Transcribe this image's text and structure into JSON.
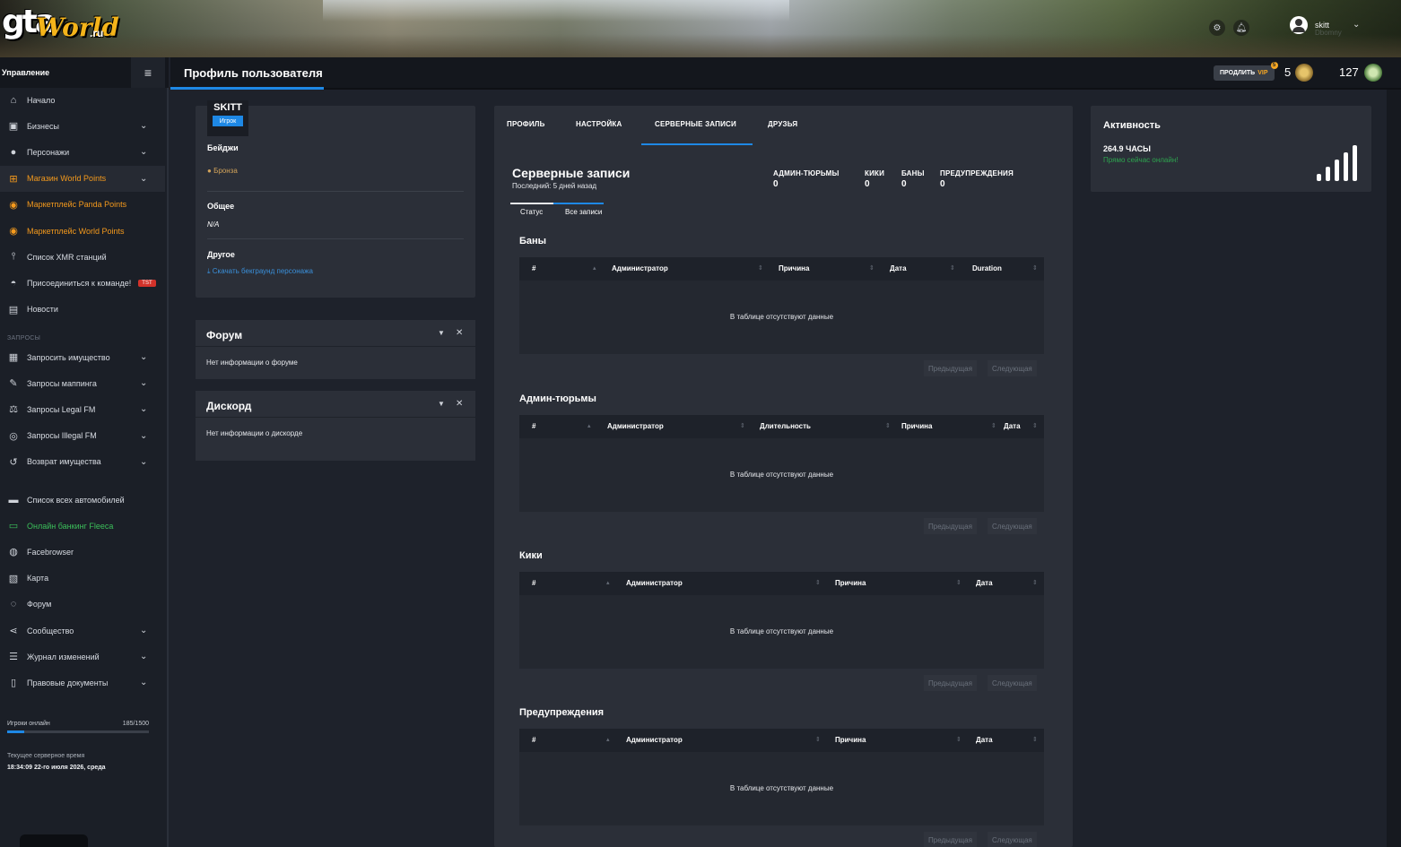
{
  "brand": {
    "logo_gta": "gta",
    "logo_world": "World",
    "logo_ru": ".ru",
    "accent": "#1e88e5",
    "orange": "#f59a1c",
    "green": "#3bbf5a"
  },
  "topbar": {
    "user_name": "skitt",
    "user_sub": "Dbomny"
  },
  "sidebar": {
    "title": "Управление",
    "items_main": [
      {
        "label": "Начало",
        "icon": "home-icon",
        "chevron": false,
        "style": ""
      },
      {
        "label": "Бизнесы",
        "icon": "briefcase-icon",
        "chevron": true,
        "style": ""
      },
      {
        "label": "Персонажи",
        "icon": "user-icon",
        "chevron": true,
        "style": ""
      },
      {
        "label": "Магазин World Points",
        "icon": "cart-icon",
        "chevron": true,
        "style": "orange"
      },
      {
        "label": "Маркетплейс Panda Points",
        "icon": "coins-icon",
        "chevron": false,
        "style": "orange"
      },
      {
        "label": "Маркетплейс World Points",
        "icon": "coins-icon",
        "chevron": false,
        "style": "orange"
      },
      {
        "label": "Список XMR станций",
        "icon": "antenna-icon",
        "chevron": false,
        "style": ""
      },
      {
        "label": "Присоединиться к команде!",
        "icon": "user-tie-icon",
        "chevron": false,
        "style": ""
      },
      {
        "label": "Новости",
        "icon": "newspaper-icon",
        "chevron": false,
        "style": ""
      }
    ],
    "tst_badge": "TST",
    "section_requests": "ЗАПРОСЫ",
    "items_requests": [
      {
        "label": "Запросить имущество",
        "icon": "building-icon",
        "chevron": true,
        "style": ""
      },
      {
        "label": "Запросы маппинга",
        "icon": "brush-icon",
        "chevron": true,
        "style": ""
      },
      {
        "label": "Запросы Legal FM",
        "icon": "scale-icon",
        "chevron": true,
        "style": ""
      },
      {
        "label": "Запросы Illegal FM",
        "icon": "mask-icon",
        "chevron": true,
        "style": ""
      },
      {
        "label": "Возврат имущества",
        "icon": "undo-icon",
        "chevron": true,
        "style": ""
      }
    ],
    "items_other": [
      {
        "label": "Список всех автомобилей",
        "icon": "car-icon",
        "chevron": false,
        "style": ""
      },
      {
        "label": "Онлайн банкинг Fleeca",
        "icon": "bank-card-icon",
        "chevron": false,
        "style": "green"
      },
      {
        "label": "Facebrowser",
        "icon": "users-icon",
        "chevron": false,
        "style": ""
      },
      {
        "label": "Карта",
        "icon": "map-icon",
        "chevron": false,
        "style": ""
      },
      {
        "label": "Форум",
        "icon": "comments-icon",
        "chevron": false,
        "style": ""
      },
      {
        "label": "Сообщество",
        "icon": "share-icon",
        "chevron": true,
        "style": ""
      },
      {
        "label": "Журнал изменений",
        "icon": "list-icon",
        "chevron": true,
        "style": ""
      },
      {
        "label": "Правовые документы",
        "icon": "document-icon",
        "chevron": true,
        "style": ""
      }
    ],
    "players_label": "Игроки онлайн",
    "players_count": "185/1500",
    "players_fraction": 0.123,
    "server_time_label": "Текущее серверное время",
    "server_time_value": "18:34:09 22-го июля 2026, среда"
  },
  "header": {
    "title": "Профиль пользователя",
    "vip_prefix": "ПРОДЛИТЬ",
    "vip_label": "VIP",
    "vip_badge": "5",
    "stat1": "5",
    "stat2": "127"
  },
  "profile": {
    "name": "SKITT",
    "role": "Игрок",
    "badges_label": "Бейджи",
    "badge_value": "Бронза",
    "general_label": "Общее",
    "general_value": "N/A",
    "other_label": "Другое",
    "download_link": "Скачать бекграунд персонажа"
  },
  "forum_panel": {
    "title": "Форум",
    "body": "Нет информации о форуме"
  },
  "discord_panel": {
    "title": "Дискорд",
    "body": "Нет информации о дискорде"
  },
  "tabs": [
    "ПРОФИЛЬ",
    "НАСТРОЙКА",
    "СЕРВЕРНЫЕ ЗАПИСИ",
    "ДРУЗЬЯ"
  ],
  "records": {
    "title": "Серверные записи",
    "last": "Последний: 5 дней назад",
    "stats": [
      {
        "label": "АДМИН-ТЮРЬМЫ",
        "value": "0"
      },
      {
        "label": "КИКИ",
        "value": "0"
      },
      {
        "label": "БАНЫ",
        "value": "0"
      },
      {
        "label": "ПРЕДУПРЕЖДЕНИЯ",
        "value": "0"
      }
    ],
    "subtabs": [
      "Статус",
      "Все записи"
    ],
    "empty_text": "В таблице отсутствуют данные",
    "prev_label": "Предыдущая",
    "next_label": "Следующая",
    "tables": [
      {
        "title": "Баны",
        "columns": [
          "#",
          "Администратор",
          "Причина",
          "Дата",
          "Duration"
        ]
      },
      {
        "title": "Админ-тюрьмы",
        "columns": [
          "#",
          "Администратор",
          "Длительность",
          "Причина",
          "Дата"
        ]
      },
      {
        "title": "Кики",
        "columns": [
          "#",
          "Администратор",
          "Причина",
          "Дата"
        ]
      },
      {
        "title": "Предупреждения",
        "columns": [
          "#",
          "Администратор",
          "Причина",
          "Дата"
        ]
      }
    ]
  },
  "activity": {
    "title": "Активность",
    "hours": "264.9 ЧАСЫ",
    "online": "Прямо сейчас онлайн!"
  }
}
